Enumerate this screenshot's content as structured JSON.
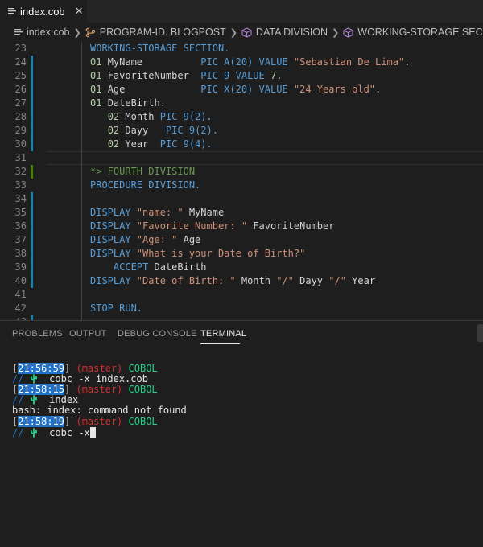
{
  "tab": {
    "label": "index.cob",
    "close": "✕"
  },
  "breadcrumb": {
    "file": "index.cob",
    "program": "PROGRAM-ID. BLOGPOST",
    "data_division": "DATA DIVISION",
    "working_storage": "WORKING-STORAGE SECTION"
  },
  "editor": {
    "lines": [
      {
        "n": "23",
        "marker": "none",
        "segments": [
          {
            "t": "WORKING-STORAGE SECTION.",
            "c": "kw"
          }
        ]
      },
      {
        "n": "24",
        "marker": "mod",
        "segments": [
          {
            "t": "01 ",
            "c": "num"
          },
          {
            "t": "MyName          ",
            "c": "plain"
          },
          {
            "t": "PIC A(20) VALUE ",
            "c": "kw"
          },
          {
            "t": "\"Sebastian De Lima\"",
            "c": "str"
          },
          {
            "t": ".",
            "c": "plain"
          }
        ]
      },
      {
        "n": "25",
        "marker": "mod",
        "segments": [
          {
            "t": "01 ",
            "c": "num"
          },
          {
            "t": "FavoriteNumber  ",
            "c": "plain"
          },
          {
            "t": "PIC 9 VALUE ",
            "c": "kw"
          },
          {
            "t": "7",
            "c": "num"
          },
          {
            "t": ".",
            "c": "plain"
          }
        ]
      },
      {
        "n": "26",
        "marker": "mod",
        "segments": [
          {
            "t": "01 ",
            "c": "num"
          },
          {
            "t": "Age             ",
            "c": "plain"
          },
          {
            "t": "PIC X(20) VALUE ",
            "c": "kw"
          },
          {
            "t": "\"24 Years old\"",
            "c": "str"
          },
          {
            "t": ".",
            "c": "plain"
          }
        ]
      },
      {
        "n": "27",
        "marker": "mod",
        "segments": [
          {
            "t": "01 ",
            "c": "num"
          },
          {
            "t": "DateBirth.",
            "c": "plain"
          }
        ]
      },
      {
        "n": "28",
        "marker": "mod",
        "segments": [
          {
            "t": "   ",
            "c": "plain"
          },
          {
            "t": "02 ",
            "c": "num"
          },
          {
            "t": "Month ",
            "c": "plain"
          },
          {
            "t": "PIC 9(2).",
            "c": "kw"
          }
        ]
      },
      {
        "n": "29",
        "marker": "mod",
        "segments": [
          {
            "t": "   ",
            "c": "plain"
          },
          {
            "t": "02 ",
            "c": "num"
          },
          {
            "t": "Dayy   ",
            "c": "plain"
          },
          {
            "t": "PIC 9(2).",
            "c": "kw"
          }
        ]
      },
      {
        "n": "30",
        "marker": "mod",
        "segments": [
          {
            "t": "   ",
            "c": "plain"
          },
          {
            "t": "02 ",
            "c": "num"
          },
          {
            "t": "Year  ",
            "c": "plain"
          },
          {
            "t": "PIC 9(4).",
            "c": "kw"
          }
        ]
      },
      {
        "n": "31",
        "marker": "none",
        "segments": []
      },
      {
        "n": "32",
        "marker": "add",
        "segments": [
          {
            "t": "*> FOURTH DIVISION",
            "c": "cmt"
          }
        ]
      },
      {
        "n": "33",
        "marker": "none",
        "segments": [
          {
            "t": "PROCEDURE DIVISION.",
            "c": "kw"
          }
        ]
      },
      {
        "n": "34",
        "marker": "mod",
        "segments": []
      },
      {
        "n": "35",
        "marker": "mod",
        "segments": [
          {
            "t": "DISPLAY ",
            "c": "kw"
          },
          {
            "t": "\"name: \"",
            "c": "str"
          },
          {
            "t": " MyName",
            "c": "plain"
          }
        ]
      },
      {
        "n": "36",
        "marker": "mod",
        "segments": [
          {
            "t": "DISPLAY ",
            "c": "kw"
          },
          {
            "t": "\"Favorite Number: \"",
            "c": "str"
          },
          {
            "t": " FavoriteNumber",
            "c": "plain"
          }
        ]
      },
      {
        "n": "37",
        "marker": "mod",
        "segments": [
          {
            "t": "DISPLAY ",
            "c": "kw"
          },
          {
            "t": "\"Age: \"",
            "c": "str"
          },
          {
            "t": " Age",
            "c": "plain"
          }
        ]
      },
      {
        "n": "38",
        "marker": "mod",
        "segments": [
          {
            "t": "DISPLAY ",
            "c": "kw"
          },
          {
            "t": "\"What is your Date of Birth?\"",
            "c": "str"
          }
        ]
      },
      {
        "n": "39",
        "marker": "mod",
        "segments": [
          {
            "t": "    ",
            "c": "plain"
          },
          {
            "t": "ACCEPT ",
            "c": "kw"
          },
          {
            "t": "DateBirth",
            "c": "plain"
          }
        ]
      },
      {
        "n": "40",
        "marker": "mod",
        "segments": [
          {
            "t": "DISPLAY ",
            "c": "kw"
          },
          {
            "t": "\"Date of Birth: \"",
            "c": "str"
          },
          {
            "t": " Month ",
            "c": "plain"
          },
          {
            "t": "\"/\"",
            "c": "str"
          },
          {
            "t": " Dayy ",
            "c": "plain"
          },
          {
            "t": "\"/\"",
            "c": "str"
          },
          {
            "t": " Year",
            "c": "plain"
          }
        ]
      },
      {
        "n": "41",
        "marker": "none",
        "segments": []
      },
      {
        "n": "42",
        "marker": "none",
        "segments": [
          {
            "t": "STOP RUN.",
            "c": "kw"
          }
        ]
      },
      {
        "n": "43",
        "marker": "mod",
        "segments": []
      }
    ]
  },
  "panel": {
    "tabs": [
      "PROBLEMS",
      "OUTPUT",
      "DEBUG CONSOLE",
      "TERMINAL"
    ],
    "active_tab": "TERMINAL"
  },
  "terminal": {
    "lines": [
      {
        "kind": "prompt",
        "time": "21:56:59",
        "branch": "(master)",
        "lang": "COBOL"
      },
      {
        "kind": "cmd",
        "cmd": "cobc -x index.cob"
      },
      {
        "kind": "prompt",
        "time": "21:58:15",
        "branch": "(master)",
        "lang": "COBOL"
      },
      {
        "kind": "cmd",
        "cmd": "index"
      },
      {
        "kind": "out",
        "text": "bash: index: command not found"
      },
      {
        "kind": "prompt",
        "time": "21:58:19",
        "branch": "(master)",
        "lang": "COBOL"
      },
      {
        "kind": "cmd",
        "cmd": "cobc -x",
        "cursor": true
      }
    ],
    "slash": "//"
  },
  "colors": {
    "kw": "#569cd6",
    "str": "#ce9178",
    "num": "#b5cea8",
    "cmt": "#6a9955",
    "modified_gutter": "#1b81a8",
    "added_gutter": "#487e02"
  }
}
